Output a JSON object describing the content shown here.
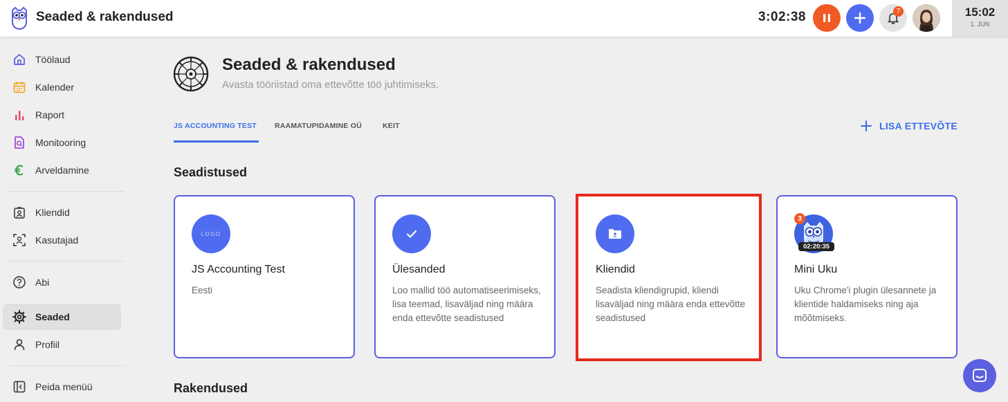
{
  "header": {
    "title": "Seaded & rakendused",
    "timer": "3:02:38",
    "notification_count": "7",
    "clock_time": "15:02",
    "clock_date": "1. JUN"
  },
  "sidebar": {
    "items": [
      {
        "label": "Töölaud",
        "icon": "home-icon"
      },
      {
        "label": "Kalender",
        "icon": "calendar-icon"
      },
      {
        "label": "Raport",
        "icon": "bar-chart-icon"
      },
      {
        "label": "Monitooring",
        "icon": "monitor-document-icon"
      },
      {
        "label": "Arveldamine",
        "icon": "euro-icon"
      },
      {
        "label": "Kliendid",
        "icon": "client-badge-icon"
      },
      {
        "label": "Kasutajad",
        "icon": "user-scan-icon"
      },
      {
        "label": "Abi",
        "icon": "help-icon"
      },
      {
        "label": "Seaded",
        "icon": "gear-icon"
      },
      {
        "label": "Profiil",
        "icon": "profile-icon"
      },
      {
        "label": "Peida menüü",
        "icon": "collapse-sidebar-icon"
      }
    ]
  },
  "page": {
    "title": "Seaded & rakendused",
    "subtitle": "Avasta tööriistad oma ettevõtte töö juhtimiseks."
  },
  "tabs": [
    {
      "label": "JS ACCOUNTING TEST"
    },
    {
      "label": "RAAMATUPIDAMINE OÜ"
    },
    {
      "label": "KEIT"
    }
  ],
  "add_company_label": "LISA ETTEVÕTE",
  "sections": {
    "settings_title": "Seadistused",
    "apps_title": "Rakendused"
  },
  "cards": [
    {
      "icon_text": "LOGO",
      "title": "JS Accounting Test",
      "desc": "Eesti"
    },
    {
      "title": "Ülesanded",
      "desc": "Loo mallid töö automatiseerimiseks, lisa teemad, lisaväljad ning määra enda ettevõtte seadistused"
    },
    {
      "title": "Kliendid",
      "desc": "Seadista kliendigrupid, kliendi lisaväljad ning määra enda ettevõtte seadistused"
    },
    {
      "title": "Mini Uku",
      "desc": "Uku Chrome'i plugin ülesannete ja klientide haldamiseks ning aja mõõtmiseks.",
      "badge": "3",
      "timer": "02:20:35"
    }
  ],
  "colors": {
    "accent": "#3a6ee8",
    "card_border": "#5b5fe0",
    "pause": "#f15a24",
    "highlight": "#e8291c"
  }
}
